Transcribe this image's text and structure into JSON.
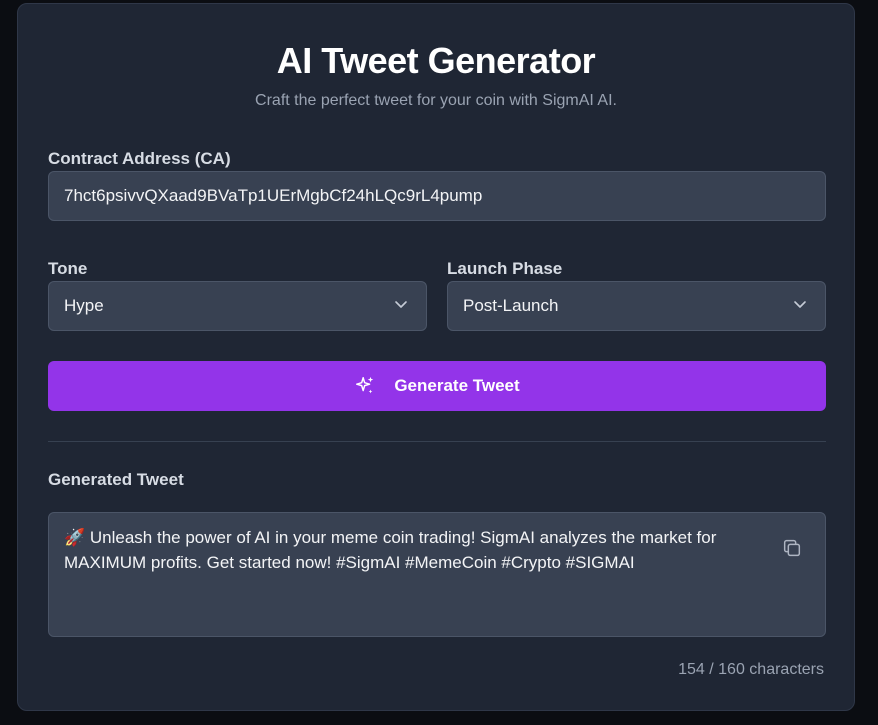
{
  "header": {
    "title": "AI Tweet Generator",
    "subtitle": "Craft the perfect tweet for your coin with SigmAI AI."
  },
  "contract": {
    "label": "Contract Address (CA)",
    "value": "7hct6psivvQXaad9BVaTp1UErMgbCf24hLQc9rL4pump"
  },
  "tone": {
    "label": "Tone",
    "selected": "Hype"
  },
  "phase": {
    "label": "Launch Phase",
    "selected": "Post-Launch"
  },
  "generate": {
    "label": "Generate Tweet",
    "icon": "sparkles-icon",
    "color": "#9334e9"
  },
  "result": {
    "label": "Generated Tweet",
    "text": "🚀 Unleash the power of AI in your meme coin trading!  SigmAI analyzes the market for MAXIMUM profits.  Get started now! #SigmAI #MemeCoin #Crypto #SIGMAI",
    "copy_icon": "copy-icon",
    "char_count": "154 / 160 characters"
  }
}
